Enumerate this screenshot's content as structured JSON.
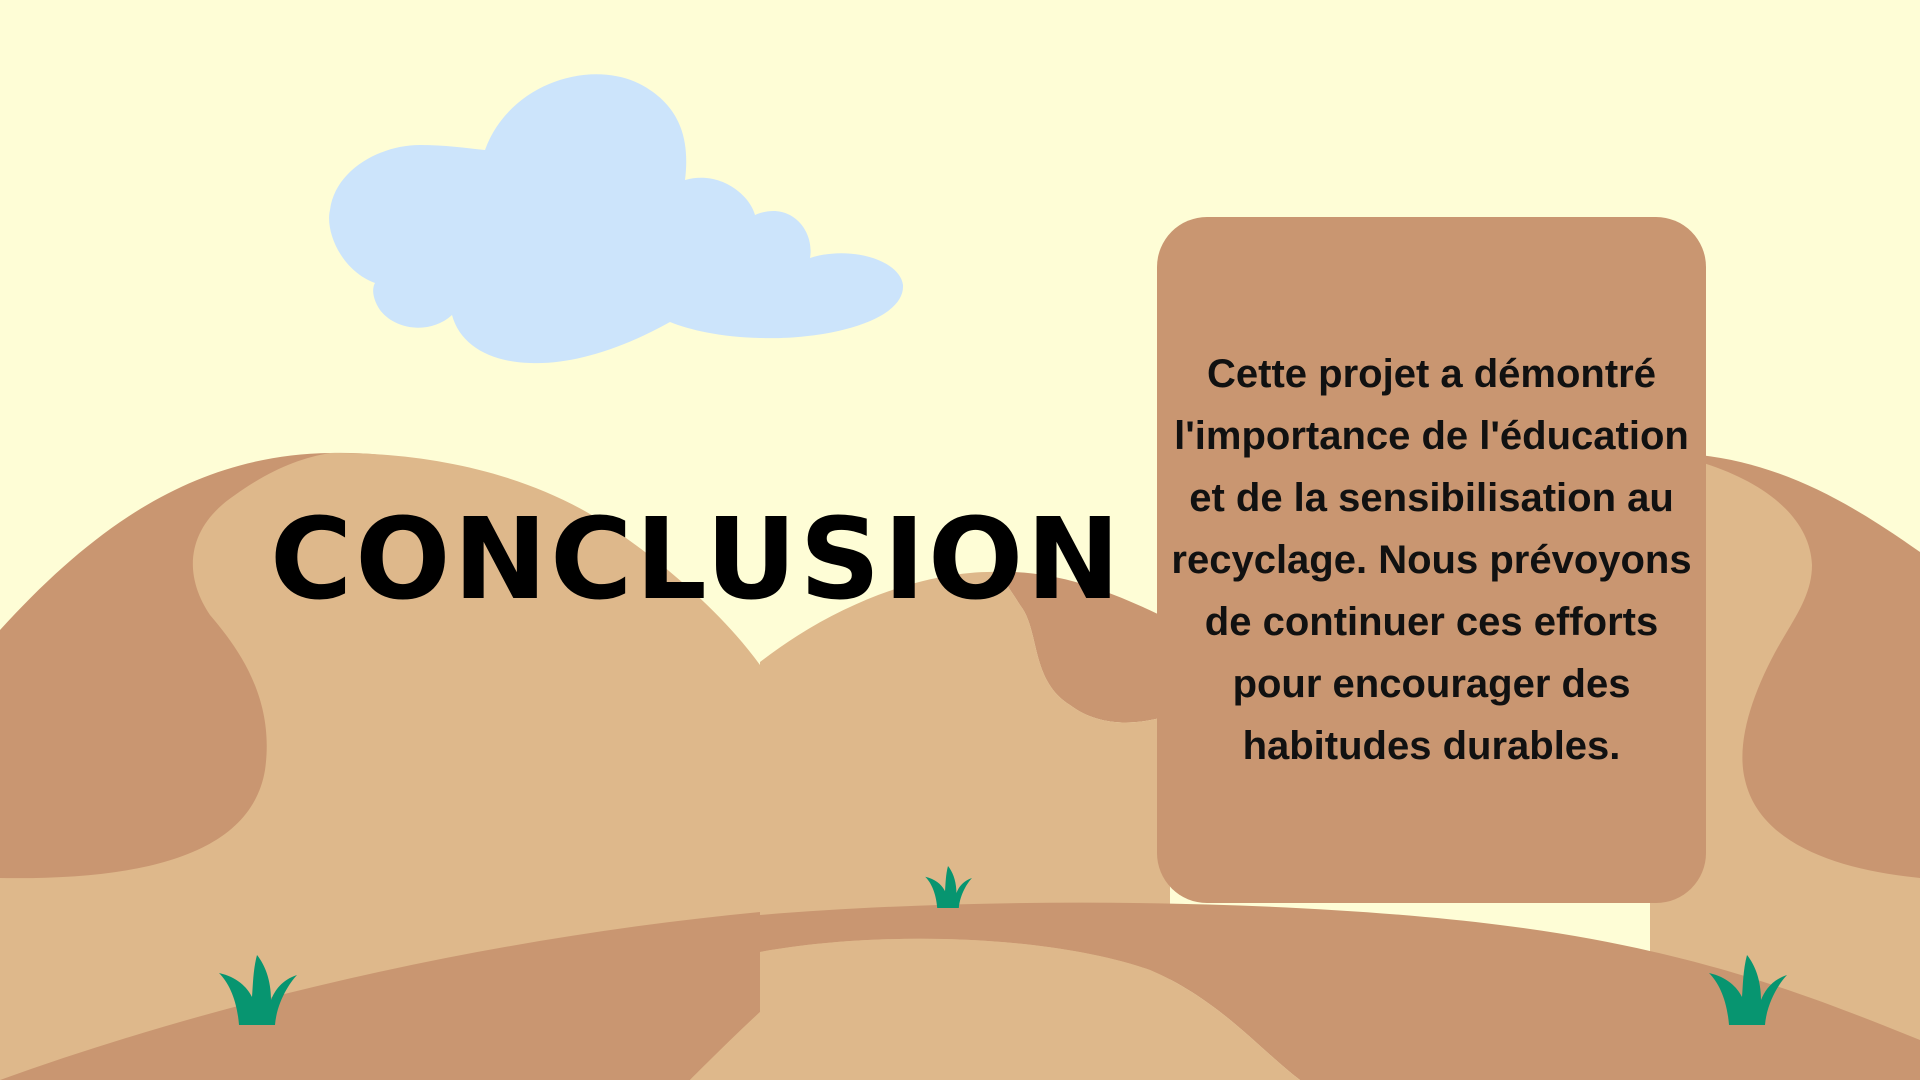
{
  "slide": {
    "title": "CONCLUSION",
    "body": "Cette projet a démontré l'importance de l'éducation et de la sensibilisation au recyclage. Nous prévoyons de continuer ces efforts pour encourager des habitudes durables."
  },
  "colors": {
    "sky": "#fefdd6",
    "cloud": "#cce4fb",
    "sand_light": "#deb88b",
    "sand_dark": "#c99671",
    "grass": "#079570",
    "title_text": "#000000",
    "card": "#c99671"
  },
  "icons": [
    "cloud-icon",
    "grass-tuft-icon"
  ]
}
